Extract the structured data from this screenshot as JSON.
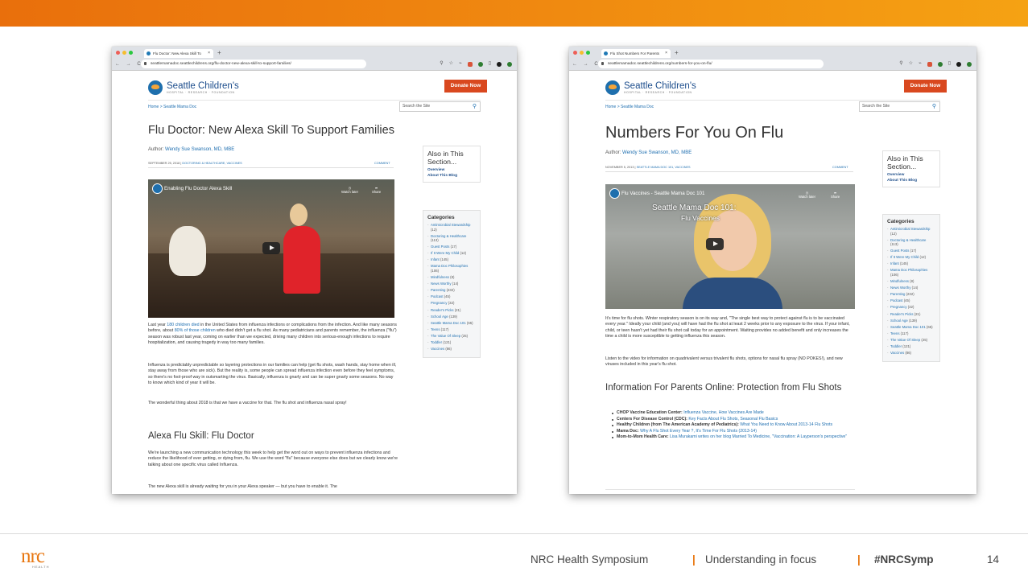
{
  "footer": {
    "logo_word": "nrc",
    "logo_sub": "HEALTH",
    "symposium": "NRC Health Symposium",
    "sep1": "|",
    "tagline": "Understanding in focus",
    "sep2": "|",
    "hashtag": "#NRCSymp",
    "page_number": "14"
  },
  "colors": {
    "accent": "#e96f0c",
    "link": "#1f6fb0",
    "donate": "#d9481f"
  },
  "shared": {
    "brand_name": "Seattle Children's",
    "brand_tag": "HOSPITAL · RESEARCH · FOUNDATION",
    "donate_label": "Donate Now",
    "breadcrumb": "Home > Seattle Mama Doc",
    "search_placeholder": "Search the Site",
    "also_title": "Also in This Section...",
    "also_links": [
      "Overview",
      "About This Blog"
    ],
    "categories_title": "Categories",
    "comment_label": "COMMENT",
    "watch_later": "Watch later",
    "share": "Share",
    "nav_buttons": "← → C"
  },
  "left": {
    "tab_title": "Flu Doctor: New Alexa Skill To",
    "url": "seattlemamadoc.seattlechildrens.org/flu-doctor-new-alexa-skill-to-support-families/",
    "title": "Flu Doctor: New Alexa Skill To Support Families",
    "author_prefix": "Author:",
    "author": "Wendy Sue Swanson, MD, MBE",
    "meta_date": "SEPTEMBER 25, 2018",
    "meta_tags": "DOCTORING & HEALTHCARE, VACCINES",
    "video_title": "Enabling Flu Doctor Alexa Skill",
    "p1_a": "Last year ",
    "p1_link1": "180 children died",
    "p1_b": " in the United States from influenza infections or complications from the infection. And like many seasons before, about ",
    "p1_link2": "80% of those children",
    "p1_c": " who died didn't get a flu shot. As many pediatricians and parents remember, the influenza (\"flu\") season was robust last year, coming on earlier than we expected, driving many children into serious-enough infections to require hospitalization, and causing tragedy in way too many families.",
    "p2": "Influenza is predictably unpredictable so layering protections in our families can help (get flu shots, wash hands, stay home when ill, stay away from those who are sick). But the reality is, some people can spread influenza infection even before they feel symptoms, so there's no fool-proof way in outsmarting the virus. Basically, influenza is gnarly and can be super gnarly some seasons. No way to know which kind of year it will be.",
    "p3": "The wonderful thing about 2018 is that we have a vaccine for that. The flu shot and influenza nasal spray!",
    "h2": "Alexa Flu Skill: Flu Doctor",
    "p4": "We're launching a new communication technology this week to help get the word out on ways to prevent influenza infections and reduce the likelihood of ever getting, or dying from, flu. We use the word \"flu\" because everyone else does but we clearly know we're talking about one specific virus called Influenza.",
    "p5": "The new Alexa skill is already waiting for you in your Alexa speaker — but you have to enable it. The",
    "categories": [
      {
        "name": "Antimicrobial Stewardship",
        "count": "(12)"
      },
      {
        "name": "Doctoring & Healthcare",
        "count": "(113)"
      },
      {
        "name": "Guest Posts",
        "count": "(17)"
      },
      {
        "name": "If It Were My Child",
        "count": "(12)"
      },
      {
        "name": "Infant",
        "count": "(145)"
      },
      {
        "name": "Mama Doc Philosophies",
        "count": "(106)"
      },
      {
        "name": "Mindfulness",
        "count": "(8)"
      },
      {
        "name": "News Worthy",
        "count": "(14)"
      },
      {
        "name": "Parenting",
        "count": "(232)"
      },
      {
        "name": "Podcast",
        "count": "(45)"
      },
      {
        "name": "Pregnancy",
        "count": "(32)"
      },
      {
        "name": "Reader's Picks",
        "count": "(21)"
      },
      {
        "name": "School Age",
        "count": "(139)"
      },
      {
        "name": "Seattle Mama Doc 101",
        "count": "(65)"
      },
      {
        "name": "Teens",
        "count": "(117)"
      },
      {
        "name": "The Value Of Sleep",
        "count": "(25)"
      },
      {
        "name": "Toddler",
        "count": "(121)"
      },
      {
        "name": "Vaccines",
        "count": "(86)"
      }
    ]
  },
  "right": {
    "tab_title": "Flu Shot Numbers For Parents",
    "url": "seattlemamadoc.seattlechildrens.org/numbers-for-you-on-flu/",
    "title": "Numbers For You On Flu",
    "author_prefix": "Author:",
    "author": "Wendy Sue Swanson, MD, MBE",
    "meta_date": "NOVEMBER 5, 2013",
    "meta_tags": "SEATTLE MAMA DOC 101, VACCINES",
    "video_title": "Flu Vaccines - Seattle Mama Doc 101",
    "video_overlay_1": "Seattle Mama Doc 101:",
    "video_overlay_2": "Flu Vaccines",
    "p1": "It's time for flu shots. Winter respiratory season is on its way and, \"The single best way to protect against flu is to be vaccinated every year.\" Ideally your child (and you) will have had the flu shot at least 2 weeks prior to any exposure to the virus. If your infant, child, or teen hasn't yet had their flu shot call today for an appointment. Waiting provides no added benefit and only increases the time a child is more susceptible to getting influenza this season.",
    "p2": "Listen to the video for information on quadrivalent versus trivalent flu shots, options for nasal flu spray (NO POKES!), and new viruses included in this year's flu shot.",
    "h2": "Information For Parents Online: Protection from Flu Shots",
    "bullets": [
      {
        "label": "CHOP Vaccine Education Center:",
        "text": " Influenza Vaccine, How Vaccines Are Made"
      },
      {
        "label": "Centers For Disease Control (CDC):",
        "text": " Key Facts About Flu Shots, Seasonal Flu Basics"
      },
      {
        "label": "Healthy Children (from The American Academy of Pediatrics):",
        "text": " What You Need to Know About 2013-14 Flu Shots"
      },
      {
        "label": "Mama Doc:",
        "text": " Why A Flu Shot Every Year ?, It's Time For Flu Shots (2013-14)"
      },
      {
        "label": "Mom-to-Mom Health Care:",
        "text": " Lisa Murakami writes on her blog Married To Medicine, \"Vaccination: A Layperson's perspective\""
      }
    ],
    "categories": [
      {
        "name": "Antimicrobial Stewardship",
        "count": "(12)"
      },
      {
        "name": "Doctoring & Healthcare",
        "count": "(113)"
      },
      {
        "name": "Guest Posts",
        "count": "(17)"
      },
      {
        "name": "If It Were My Child",
        "count": "(12)"
      },
      {
        "name": "Infant",
        "count": "(145)"
      },
      {
        "name": "Mama Doc Philosophies",
        "count": "(106)"
      },
      {
        "name": "Mindfulness",
        "count": "(8)"
      },
      {
        "name": "News Worthy",
        "count": "(14)"
      },
      {
        "name": "Parenting",
        "count": "(232)"
      },
      {
        "name": "Podcast",
        "count": "(45)"
      },
      {
        "name": "Pregnancy",
        "count": "(32)"
      },
      {
        "name": "Reader's Picks",
        "count": "(21)"
      },
      {
        "name": "School Age",
        "count": "(139)"
      },
      {
        "name": "Seattle Mama Doc 101",
        "count": "(65)"
      },
      {
        "name": "Teens",
        "count": "(117)"
      },
      {
        "name": "The Value Of Sleep",
        "count": "(25)"
      },
      {
        "name": "Toddler",
        "count": "(121)"
      },
      {
        "name": "Vaccines",
        "count": "(86)"
      }
    ]
  }
}
